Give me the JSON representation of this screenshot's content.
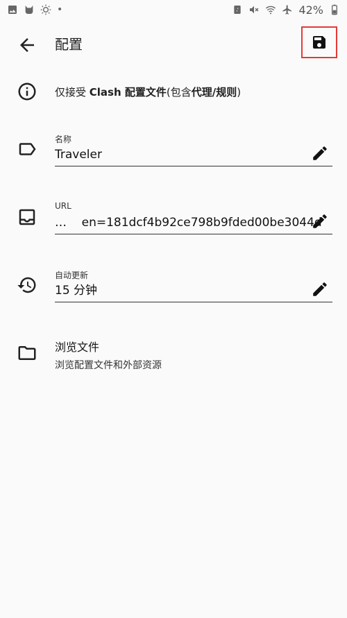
{
  "status_bar": {
    "left_icons": [
      "image-icon",
      "cat-icon",
      "brightness-icon"
    ],
    "battery_percent": "42%",
    "right_icons": [
      "sync-icon",
      "mute-icon",
      "wifi-icon",
      "airplane-icon",
      "battery-icon"
    ]
  },
  "app_bar": {
    "title": "配置"
  },
  "info": {
    "prefix": "仅接受 ",
    "bold1": "Clash 配置文件",
    "middle": "(包含",
    "bold2": "代理/规则",
    "suffix": ")"
  },
  "fields": {
    "name": {
      "label": "名称",
      "value": "Traveler"
    },
    "url": {
      "label": "URL",
      "value": "…    en=181dcf4b92ce798b9fded00be3044d"
    },
    "auto_update": {
      "label": "自动更新",
      "value": "15 分钟"
    }
  },
  "browse": {
    "title": "浏览文件",
    "subtitle": "浏览配置文件和外部资源"
  },
  "colors": {
    "background": "#fafafa",
    "highlight": "#e53935",
    "text": "#1f1f1f"
  }
}
